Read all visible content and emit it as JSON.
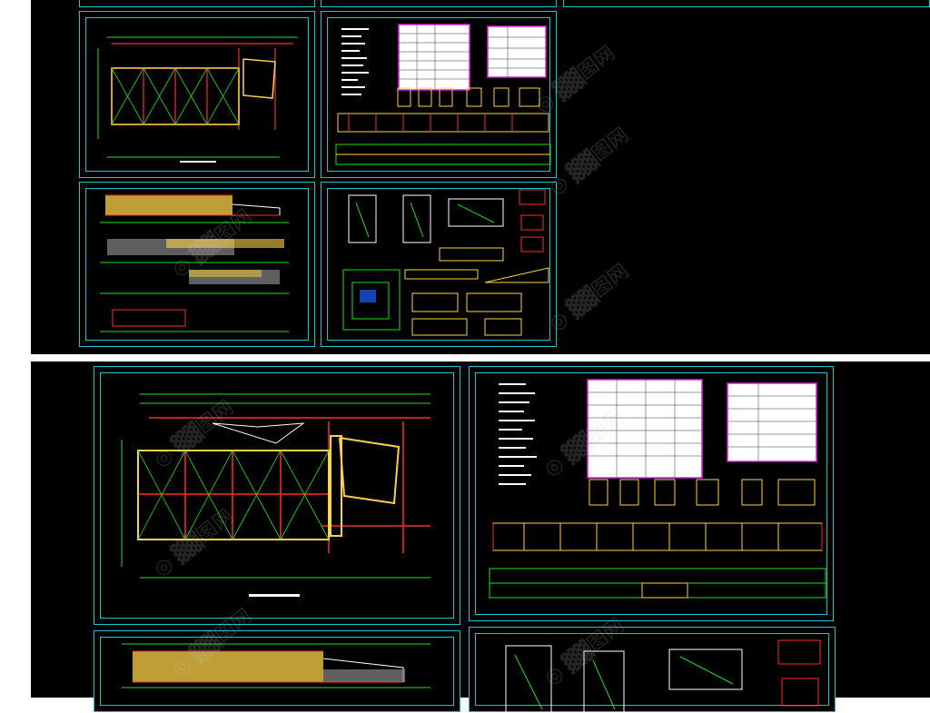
{
  "colors": {
    "frame": "#16c9c9",
    "grid": "#ff2a2a",
    "dim": "#1fe01f",
    "wall": "#ffd24a",
    "table": "#ffffff",
    "table_border": "#e020e0",
    "background": "#000000"
  },
  "top_panel": {
    "sheets": [
      {
        "name": "floor-plan-small",
        "caption": ""
      },
      {
        "name": "schedule-sheet-small",
        "caption": ""
      },
      {
        "name": "elevation-sheet-small",
        "caption": ""
      },
      {
        "name": "detail-sheet-small",
        "caption": ""
      }
    ]
  },
  "bottom_panel": {
    "sheets": [
      {
        "name": "floor-plan-large",
        "caption": ""
      },
      {
        "name": "schedule-sheet-large",
        "caption": ""
      },
      {
        "name": "elevation-sheet-large",
        "caption": ""
      },
      {
        "name": "detail-sheet-large",
        "caption": ""
      }
    ]
  },
  "watermark_icon": "logo-watermark-icon"
}
